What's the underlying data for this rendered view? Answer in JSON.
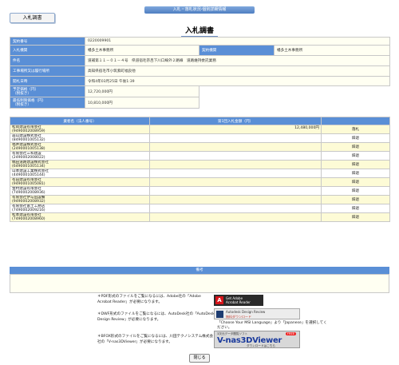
{
  "header": {
    "title": "入札・落札状況-個別詳細情報"
  },
  "tab": {
    "label": "入札調書"
  },
  "page_title": "入札調書",
  "info": {
    "contract_no": {
      "label": "契約番号",
      "value": "0220009901"
    },
    "bid_org": {
      "label": "入札機関",
      "value": "幡多土木事務所"
    },
    "contract_org": {
      "label": "契約機関",
      "value": "幡多土木事務所"
    },
    "item_name": {
      "label": "件名",
      "value": "道補第１１－０１－４号　県道宿毛宗呂下川口線外２路線　道路維持委託業務"
    },
    "location": {
      "label": "工事場所又は履行場所",
      "value": "高知県宿毛市小筑紫町福良他"
    },
    "open_date": {
      "label": "開札日時",
      "value": "令和4年03月25日 午後1:39"
    },
    "est_price": {
      "label": "予定価格（円）\n（税抜き）",
      "value": "12,720,000円"
    },
    "min_price": {
      "label": "最低制限価格（円）\n（税抜き）",
      "value": "10,810,000円"
    }
  },
  "bid_table": {
    "headers": [
      "業者名（法人番号）",
      "第1回入札金額（円）",
      ""
    ],
    "rows": [
      {
        "name": "松岡建設有限会社",
        "id": "(9490002008959)",
        "amount": "12,480,000円",
        "result": "落札"
      },
      {
        "name": "森山建設株式会社",
        "id": "(8490001005132)",
        "amount": "",
        "result": "辞退"
      },
      {
        "name": "福井建設株式会社",
        "id": "(2490001005138)",
        "amount": "",
        "result": "辞退"
      },
      {
        "name": "有限会社三和建設",
        "id": "(2490002008022)",
        "amount": "",
        "result": "辞退"
      },
      {
        "name": "橋田道路建設株式会社",
        "id": "(6490001005134)",
        "amount": "",
        "result": "辞退"
      },
      {
        "name": "山本建設工業株式会社",
        "id": "(4490001005144)",
        "amount": "",
        "result": "辞退"
      },
      {
        "name": "有田建設有限会社",
        "id": "(9490001005081)",
        "amount": "",
        "result": "辞退"
      },
      {
        "name": "金村建設有限会社",
        "id": "(7490002008936)",
        "amount": "",
        "result": "辞退"
      },
      {
        "name": "有限会社伊与田設備",
        "id": "(9490002008932)",
        "amount": "",
        "result": "辞退"
      },
      {
        "name": "有限会社富士工務店",
        "id": "(7490002009216)",
        "amount": "",
        "result": "辞退"
      },
      {
        "name": "松本建設有限会社",
        "id": "(7490002008960)",
        "amount": "",
        "result": "辞退"
      }
    ]
  },
  "remarks": {
    "label": "備考",
    "value": ""
  },
  "notes": {
    "pdf": "＊PDF形式のファイルをご覧になるには、Adobe社の「Adobe Acrobat Reader」が必要になります。",
    "dwf": "＊DWF形式のファイルをご覧になるには、AutoDesk社の「AutoDesk Design Review」が必要になります。",
    "bfo": "＊BFOX形式のファイルをご覧になるには、川田テクノシステム株式会社の「V-nas3DViewer」が必要になります。",
    "dwf_lang": "「Choose Your MSI Language」より「Japanese」を選択してください。"
  },
  "badges": {
    "adobe_line1": "Get Adobe",
    "adobe_line2": "Acrobat Reader",
    "design_line1": "Autodesk Design Review",
    "design_line2": "無料ダウンロード",
    "vnas_line1": "3次元データ閲覧ソフト",
    "vnas_line2": "V-nas3DViewer",
    "vnas_line3": "ダウンロードはこちら",
    "vnas_free": "FREE"
  },
  "close_button": {
    "label": "閉じる"
  },
  "colors": {
    "accent": "#5a8fd6",
    "row_highlight": "#fdfbd6",
    "header_blue": "#4f7fc2"
  }
}
